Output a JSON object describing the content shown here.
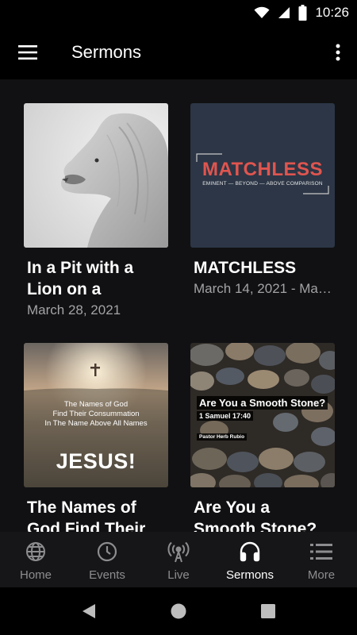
{
  "status_bar": {
    "time": "10:26"
  },
  "app_bar": {
    "title": "Sermons",
    "menu_icon": "hamburger-menu-icon",
    "overflow_icon": "more-vertical-icon"
  },
  "sermons": [
    {
      "title": "In a Pit with a Lion on a Snow…",
      "date": "March 28, 2021"
    },
    {
      "title": "MATCHLESS",
      "date": "March 14, 2021 - Ma…",
      "art_title": "MATCHLESS",
      "art_subtitle": "EMINENT — BEYOND — ABOVE COMPARISON"
    },
    {
      "title": "The Names of God Find Their …",
      "date": "",
      "art_line1": "The Names of God",
      "art_line2": "Find Their Consummation",
      "art_line3": "In The Name Above All Names",
      "art_big": "JESUS!"
    },
    {
      "title": "Are You a Smooth Stone?",
      "date": "",
      "art_title": "Are You a Smooth Stone?",
      "art_verse": "1 Samuel 17:40",
      "art_pastor": "Pastor Herb Rubio"
    }
  ],
  "bottom_nav": [
    {
      "label": "Home",
      "icon": "globe-icon",
      "active": false
    },
    {
      "label": "Events",
      "icon": "clock-icon",
      "active": false
    },
    {
      "label": "Live",
      "icon": "broadcast-icon",
      "active": false
    },
    {
      "label": "Sermons",
      "icon": "headphones-icon",
      "active": true
    },
    {
      "label": "More",
      "icon": "list-icon",
      "active": false
    }
  ],
  "colors": {
    "background": "#111113",
    "nav_bg": "#161618",
    "active": "#ffffff",
    "inactive": "#8d8d90",
    "accent_red": "#e0554f"
  }
}
